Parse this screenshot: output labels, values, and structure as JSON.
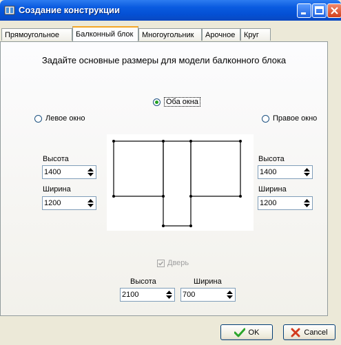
{
  "window": {
    "title": "Создание конструкции",
    "colors": {
      "titlebar": "#0450d4",
      "face": "#ece9d8",
      "tab_highlight": "#f5a623"
    }
  },
  "tabs": [
    {
      "label": "Прямоугольное"
    },
    {
      "label": "Балконный блок"
    },
    {
      "label": "Многоугольник"
    },
    {
      "label": "Арочное"
    },
    {
      "label": "Круг"
    }
  ],
  "active_tab": "Балконный блок",
  "heading": "Задайте основные размеры для модели балконного блока",
  "options": {
    "both": {
      "label": "Оба окна",
      "checked": true
    },
    "left": {
      "label": "Левое окно",
      "checked": false
    },
    "right": {
      "label": "Правое окно",
      "checked": false
    }
  },
  "left_window": {
    "height_label": "Высота",
    "height_value": "1400",
    "width_label": "Ширина",
    "width_value": "1200"
  },
  "right_window": {
    "height_label": "Высота",
    "height_value": "1400",
    "width_label": "Ширина",
    "width_value": "1200"
  },
  "door": {
    "checkbox_label": "Дверь",
    "checked": true,
    "enabled": false,
    "height_label": "Высота",
    "height_value": "2100",
    "width_label": "Ширина",
    "width_value": "700"
  },
  "buttons": {
    "ok": "OK",
    "cancel": "Cancel"
  }
}
